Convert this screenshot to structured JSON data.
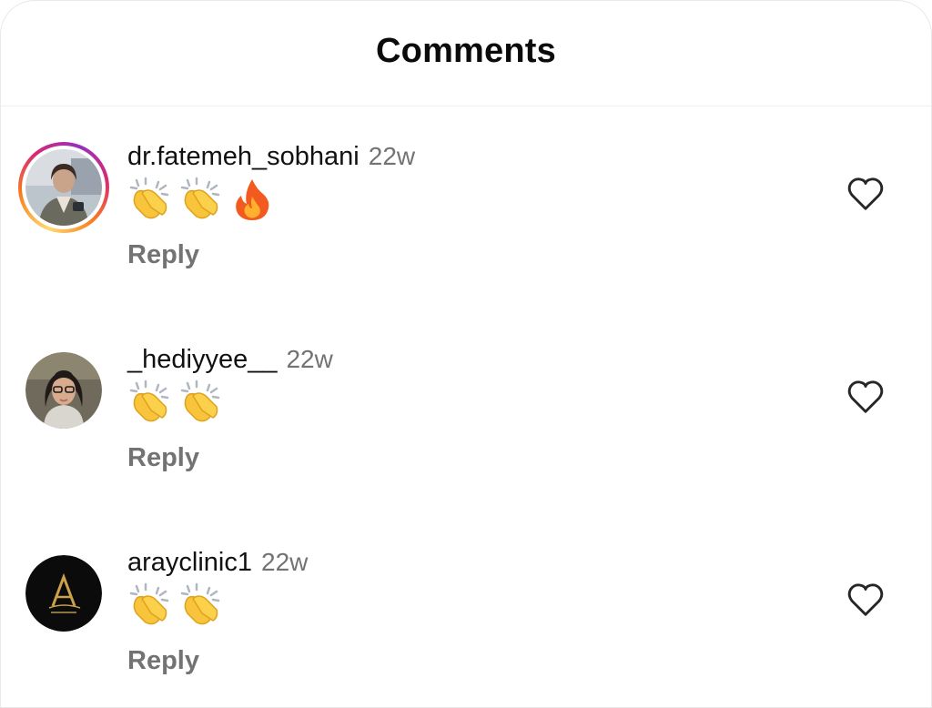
{
  "header": {
    "title": "Comments"
  },
  "comments": [
    {
      "username": "dr.fatemeh_sobhani",
      "time": "22w",
      "emojis": [
        "clapping-hands-emoji",
        "clapping-hands-emoji",
        "fire-emoji"
      ],
      "reply_label": "Reply",
      "avatar_ring": "story"
    },
    {
      "username": "_hediyyee__",
      "time": "22w",
      "emojis": [
        "clapping-hands-emoji",
        "clapping-hands-emoji"
      ],
      "reply_label": "Reply",
      "avatar_ring": "none"
    },
    {
      "username": "arayclinic1",
      "time": "22w",
      "emojis": [
        "clapping-hands-emoji",
        "clapping-hands-emoji"
      ],
      "reply_label": "Reply",
      "avatar_ring": "none",
      "avatar_logo": "Aray"
    }
  ],
  "colors": {
    "text_primary": "#111111",
    "text_secondary": "#737373",
    "divider": "#efefef",
    "heart_stroke": "#262626"
  },
  "icons": {
    "like": "heart-outline-icon"
  }
}
